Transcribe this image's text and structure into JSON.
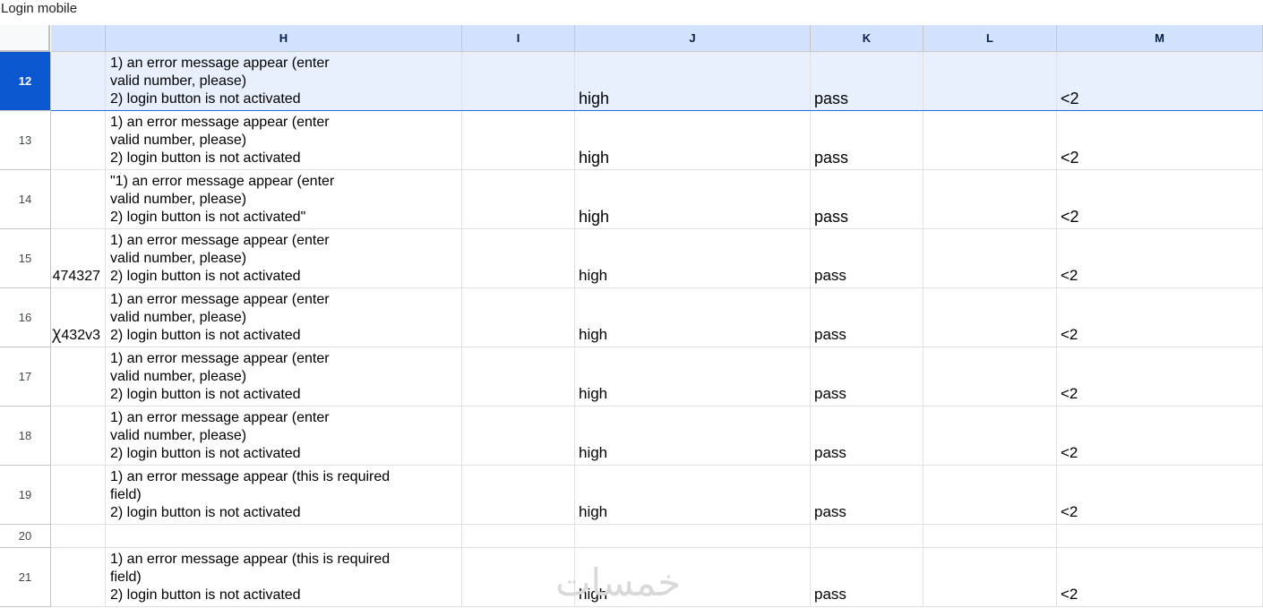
{
  "sheet": {
    "title": "Login mobile"
  },
  "columns": [
    "H",
    "I",
    "J",
    "K",
    "L",
    "M"
  ],
  "rows": [
    {
      "num": "12",
      "selected": true,
      "g": "",
      "h": "1) an  error message appear (enter\nvalid number, please)\n2) login button is not activated",
      "j": "high",
      "k": "pass",
      "m": "<2",
      "big": true
    },
    {
      "num": "13",
      "g": "",
      "h": "1) an  error message appear (enter\nvalid number, please)\n2) login button is not activated",
      "j": "high",
      "k": "pass",
      "m": "<2",
      "big": true
    },
    {
      "num": "14",
      "g": "",
      "h": "\"1) an  error message appear (enter\nvalid number, please)\n2) login button is not activated\"",
      "j": "high",
      "k": "pass",
      "m": "<2",
      "big": true
    },
    {
      "num": "15",
      "g": "474327",
      "h": "1) an  error message appear (enter\nvalid number, please)\n2) login button is not activated",
      "j": "high",
      "k": "pass",
      "m": "<2"
    },
    {
      "num": "16",
      "g": "Ꭓ432v3",
      "h": "1) an  error message appear (enter\nvalid number, please)\n2) login button is not activated",
      "j": "high",
      "k": "pass",
      "m": "<2"
    },
    {
      "num": "17",
      "g": "",
      "h": "1) an  error message appear (enter\nvalid number, please)\n2) login button is not activated",
      "j": "high",
      "k": "pass",
      "m": "<2"
    },
    {
      "num": "18",
      "g": "",
      "h": "1) an  error message appear (enter\nvalid number, please)\n2) login button is not activated",
      "j": "high",
      "k": "pass",
      "m": "<2"
    },
    {
      "num": "19",
      "g": "",
      "h": "1) an  error message appear (this is required\nfield)\n2) login button is not activated",
      "j": "high",
      "k": "pass",
      "m": "<2"
    },
    {
      "num": "20",
      "short": true,
      "g": "",
      "h": "",
      "j": "",
      "k": "",
      "m": ""
    },
    {
      "num": "21",
      "g": "",
      "h": "1) an  error message appear (this is required\nfield)\n2) login button is not activated",
      "j": "high",
      "k": "pass",
      "m": "<2"
    }
  ],
  "watermark": "خمسات",
  "colors": {
    "header_bg": "#d3e3fd",
    "selected_row_num": "#0b57d0",
    "selected_row_bg": "#e8effd"
  }
}
